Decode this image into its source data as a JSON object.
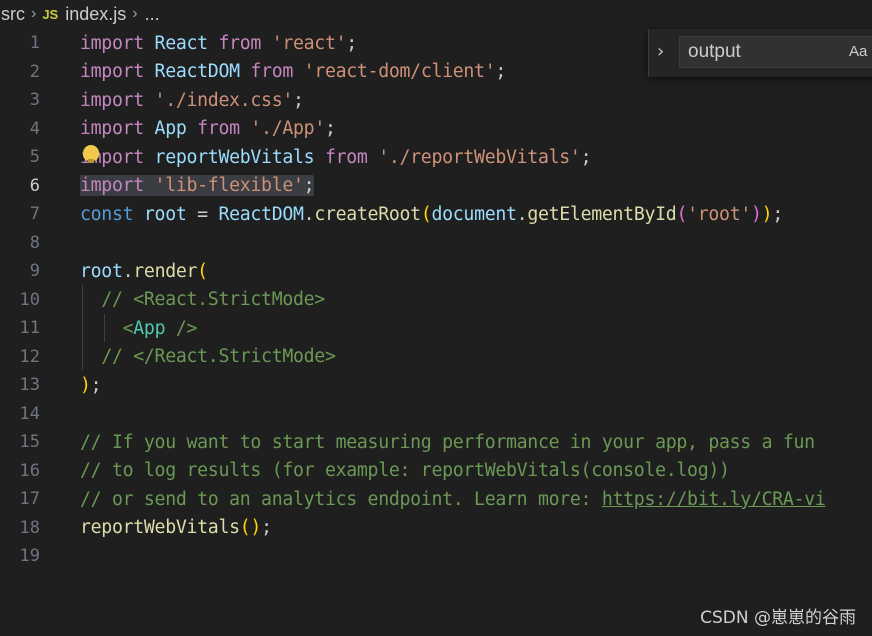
{
  "breadcrumb": {
    "folder": "src",
    "file_icon": "JS",
    "file": "index.js",
    "more": "..."
  },
  "find_widget": {
    "value": "output",
    "match_case_label": "Aa"
  },
  "lines": [
    {
      "n": "1",
      "tokens": [
        [
          "kw",
          "import"
        ],
        [
          "",
          ""
        ],
        [
          "var",
          " React"
        ],
        [
          "kw",
          " from"
        ],
        [
          "str",
          " 'react'"
        ],
        [
          "",
          ";"
        ]
      ]
    },
    {
      "n": "2",
      "tokens": [
        [
          "kw",
          "import"
        ],
        [
          "var",
          " ReactDOM"
        ],
        [
          "kw",
          " from"
        ],
        [
          "str",
          " 'react-dom/client'"
        ],
        [
          "",
          ";"
        ]
      ]
    },
    {
      "n": "3",
      "tokens": [
        [
          "kw",
          "import"
        ],
        [
          "str",
          " './index.css'"
        ],
        [
          "",
          ";"
        ]
      ]
    },
    {
      "n": "4",
      "tokens": [
        [
          "kw",
          "import"
        ],
        [
          "var",
          " App"
        ],
        [
          "kw",
          " from"
        ],
        [
          "str",
          " './App'"
        ],
        [
          "",
          ";"
        ]
      ]
    },
    {
      "n": "5",
      "tokens": [
        [
          "kw",
          "import"
        ],
        [
          "var",
          " reportWebVitals"
        ],
        [
          "kw",
          " from"
        ],
        [
          "str",
          " './reportWebVitals'"
        ],
        [
          "",
          ";"
        ]
      ]
    },
    {
      "n": "6",
      "tokens": [
        [
          "kw",
          "import"
        ],
        [
          "str",
          " 'lib-flexible'"
        ],
        [
          "",
          ";"
        ]
      ]
    },
    {
      "n": "7",
      "tokens": [
        [
          "kwblue",
          "const"
        ],
        [
          "var",
          " root"
        ],
        [
          "",
          " = "
        ],
        [
          "var",
          "ReactDOM"
        ],
        [
          "",
          "."
        ],
        [
          "fn",
          "createRoot"
        ],
        [
          "paren1",
          "("
        ],
        [
          "var",
          "document"
        ],
        [
          "",
          "."
        ],
        [
          "fn",
          "getElementById"
        ],
        [
          "paren2",
          "("
        ],
        [
          "str",
          "'root'"
        ],
        [
          "paren2",
          ")"
        ],
        [
          "paren1",
          ")"
        ],
        [
          "",
          ";"
        ]
      ]
    },
    {
      "n": "8",
      "tokens": []
    },
    {
      "n": "9",
      "tokens": [
        [
          "var",
          "root"
        ],
        [
          "",
          "."
        ],
        [
          "fn",
          "render"
        ],
        [
          "paren1",
          "("
        ]
      ]
    },
    {
      "n": "10",
      "tokens": [
        [
          "",
          "  "
        ],
        [
          "cmt",
          "// <React.StrictMode>"
        ]
      ]
    },
    {
      "n": "11",
      "tokens": [
        [
          "",
          "    "
        ],
        [
          "cmt",
          "<"
        ],
        [
          "cls",
          "App"
        ],
        [
          "cmt",
          " />"
        ]
      ]
    },
    {
      "n": "12",
      "tokens": [
        [
          "",
          "  "
        ],
        [
          "cmt",
          "// </React.StrictMode>"
        ]
      ]
    },
    {
      "n": "13",
      "tokens": [
        [
          "paren1",
          ")"
        ],
        [
          "",
          ";"
        ]
      ]
    },
    {
      "n": "14",
      "tokens": []
    },
    {
      "n": "15",
      "tokens": [
        [
          "cmt",
          "// If you want to start measuring performance in your app, pass a fun"
        ]
      ]
    },
    {
      "n": "16",
      "tokens": [
        [
          "cmt",
          "// to log results (for example: reportWebVitals(console.log))"
        ]
      ]
    },
    {
      "n": "17",
      "tokens": [
        [
          "cmt",
          "// or send to an analytics endpoint. Learn more: "
        ],
        [
          "cmt link",
          "https://bit.ly/CRA-vi"
        ]
      ]
    },
    {
      "n": "18",
      "tokens": [
        [
          "fn",
          "reportWebVitals"
        ],
        [
          "paren1",
          "()"
        ],
        [
          "",
          ";"
        ]
      ]
    },
    {
      "n": "19",
      "tokens": []
    }
  ],
  "watermark": "CSDN @崽崽的谷雨"
}
